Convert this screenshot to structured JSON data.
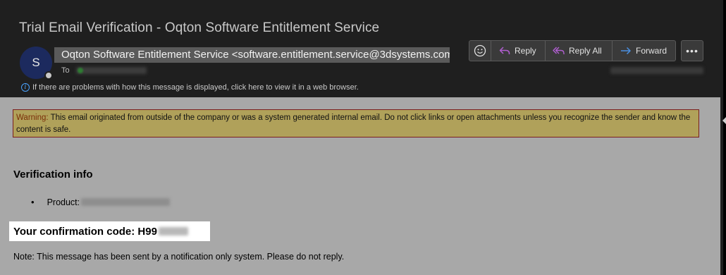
{
  "message": {
    "subject": "Trial Email Verification - Oqton Software Entitlement Service",
    "sender": "Oqton Software Entitlement Service <software.entitlement.service@3dsystems.com",
    "avatar_initial": "S",
    "to_label": "To"
  },
  "actions": {
    "reply": "Reply",
    "reply_all": "Reply All",
    "forward": "Forward",
    "more": "•••"
  },
  "info_bar": {
    "text": "If there are problems with how this message is displayed, click here to view it in a web browser."
  },
  "body": {
    "warning_label": "Warning:",
    "warning_text": " This email originated from outside of the company or was a system generated internal email. Do not click links or open attachments unless you recognize the sender and know the content is safe.",
    "heading": "Verification info",
    "product_label": "Product:",
    "code_label": "Your confirmation code: H99",
    "note": "Note: This message has been sent by a notification only system. Please do not reply."
  },
  "colors": {
    "background": "#1f1f1f",
    "body_background": "#a8a8a8",
    "warning_background": "#b0a15a",
    "reply_icon": "#b05fd0",
    "forward_icon": "#4a90e2",
    "avatar": "#1c2a5e"
  },
  "icons": [
    "emoji-icon",
    "reply-icon",
    "reply-all-icon",
    "forward-icon",
    "more-icon",
    "info-icon"
  ]
}
